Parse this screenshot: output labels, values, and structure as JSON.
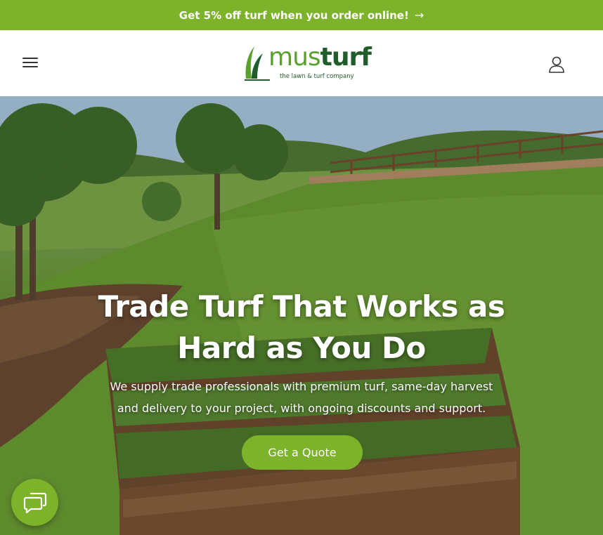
{
  "announcement": {
    "text": "Get 5% off turf when you order online!",
    "arrow_icon": "arrow-right-icon"
  },
  "header": {
    "menu_icon": "hamburger-menu-icon",
    "logo": {
      "word_part1": "mus",
      "word_part2": "turf",
      "tagline": "the lawn & turf company"
    },
    "account_icon": "user-account-icon"
  },
  "hero": {
    "title_line1": "Trade Turf That Works as",
    "title_line2": "Hard as You Do",
    "subtitle_line1": "We supply trade professionals with premium turf, same-day harvest",
    "subtitle_line2": "and delivery to your project, with ongoing discounts and support.",
    "cta_label": "Get a Quote"
  },
  "chat": {
    "icon": "chat-bubbles-icon"
  },
  "colors": {
    "brand_green": "#7cb32a",
    "dark_green": "#1f5d2b",
    "white": "#ffffff"
  }
}
